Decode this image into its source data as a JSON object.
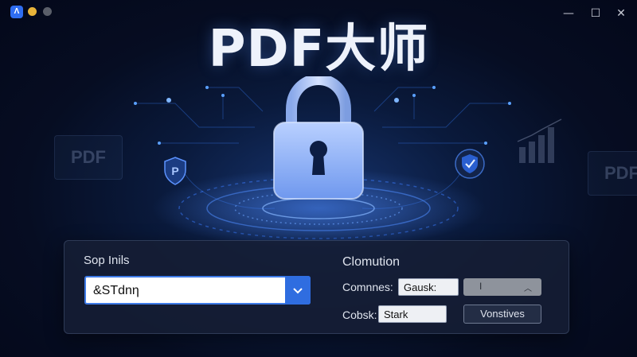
{
  "window": {
    "title": "PDF大师",
    "controls": {
      "minimize": "—",
      "maximize": "☐",
      "close": "✕"
    }
  },
  "icons": {
    "app": "app-logo-icon",
    "lock": "padlock-icon",
    "shield_left": "shield-p-icon",
    "shield_right": "shield-check-icon",
    "dropdown": "chevron-down-icon",
    "select_caret": "chevron-up-icon"
  },
  "colors": {
    "accent": "#2f6de0",
    "panel": "#161e34",
    "title": "#eef2fb"
  },
  "background": {
    "ghost_left": "PDF",
    "ghost_right": "PDF"
  },
  "panel": {
    "left_label": "Sop Inils",
    "main_field_value": "&STdnη",
    "right_label": "Clomution",
    "row1_label": "Comnnes:",
    "row1_input": "Gausk:",
    "row1_select": "I",
    "row2_label": "Cobsk:",
    "row2_input": "Stark",
    "button_label": "Vonstives"
  }
}
